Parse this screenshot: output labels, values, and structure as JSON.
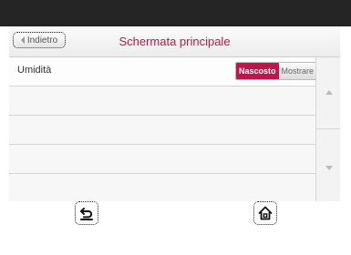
{
  "header": {
    "back_label": "Indietro",
    "title": "Schermata principale"
  },
  "list": {
    "rows": [
      {
        "label": "Umidità",
        "options": [
          "Nascosto",
          "Mostrare"
        ],
        "selected": "Nascosto"
      }
    ]
  },
  "colors": {
    "accent": "#c0144a",
    "topbar": "#252525"
  },
  "icons": {
    "back": "back-arrow-icon",
    "home": "home-icon"
  }
}
